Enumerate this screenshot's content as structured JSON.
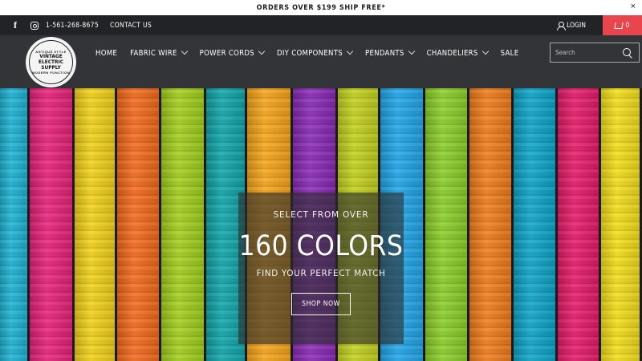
{
  "announcement": {
    "text": "ORDERS OVER $199 SHIP FREE*",
    "close": "×"
  },
  "topbar": {
    "facebook_glyph": "f",
    "phone": "1-561-268-8675",
    "contact": "CONTACT US",
    "login": "LOGIN",
    "cart_count": "0",
    "cart_color": "#e8464c"
  },
  "logo": {
    "arc_top": "ANTIQUE STYLE",
    "name_line1": "VINTAGE ELECTRIC",
    "name_line2": "SUPPLY",
    "arc_bottom": "MODERN FUNCTION"
  },
  "nav": {
    "items": [
      {
        "label": "HOME",
        "dropdown": false
      },
      {
        "label": "FABRIC WIRE",
        "dropdown": true
      },
      {
        "label": "POWER CORDS",
        "dropdown": true
      },
      {
        "label": "DIY COMPONENTS",
        "dropdown": true
      },
      {
        "label": "PENDANTS",
        "dropdown": true
      },
      {
        "label": "CHANDELIERS",
        "dropdown": true
      },
      {
        "label": "SALE",
        "dropdown": false
      }
    ]
  },
  "search": {
    "placeholder": "Search"
  },
  "hero": {
    "pre_title": "SELECT FROM OVER",
    "headline": "160 COLORS",
    "subtitle": "FIND YOUR PERFECT MATCH",
    "cta": "SHOP NOW",
    "plank_colors": [
      "#1fb3d3",
      "#e8237b",
      "#f2d21a",
      "#f36b1d",
      "#a4cf1d",
      "#12a6a9",
      "#f5a51a",
      "#8a2bb6",
      "#c3d11e",
      "#22a6e8",
      "#8ccf2a",
      "#f07d1c",
      "#0fa5c9",
      "#e61c6b",
      "#f3de1b"
    ]
  }
}
